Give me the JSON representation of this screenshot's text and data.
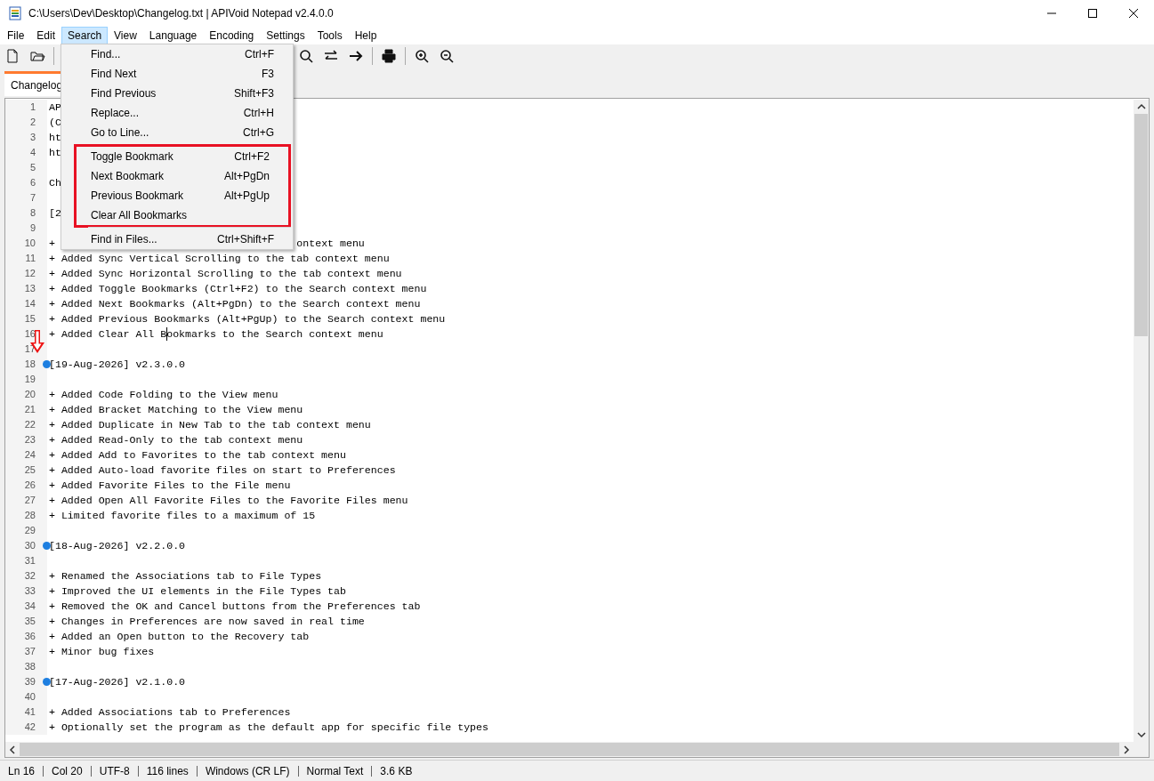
{
  "window": {
    "title": "C:\\Users\\Dev\\Desktop\\Changelog.txt | APIVoid Notepad v2.4.0.0"
  },
  "menu_bar": [
    {
      "label": "File",
      "selected": false
    },
    {
      "label": "Edit",
      "selected": false
    },
    {
      "label": "Search",
      "selected": true
    },
    {
      "label": "View",
      "selected": false
    },
    {
      "label": "Language",
      "selected": false
    },
    {
      "label": "Encoding",
      "selected": false
    },
    {
      "label": "Settings",
      "selected": false
    },
    {
      "label": "Tools",
      "selected": false
    },
    {
      "label": "Help",
      "selected": false
    }
  ],
  "tabs": [
    {
      "label": "Changelog",
      "selected": true
    }
  ],
  "search_menu": {
    "groups": [
      {
        "highlighted": false,
        "items": [
          {
            "label": "Find...",
            "shortcut": "Ctrl+F"
          },
          {
            "label": "Find Next",
            "shortcut": "F3"
          },
          {
            "label": "Find Previous",
            "shortcut": "Shift+F3"
          },
          {
            "label": "Replace...",
            "shortcut": "Ctrl+H"
          },
          {
            "label": "Go to Line...",
            "shortcut": "Ctrl+G"
          }
        ]
      },
      {
        "highlighted": true,
        "items": [
          {
            "label": "Toggle Bookmark",
            "shortcut": "Ctrl+F2"
          },
          {
            "label": "Next Bookmark",
            "shortcut": "Alt+PgDn"
          },
          {
            "label": "Previous Bookmark",
            "shortcut": "Alt+PgUp"
          },
          {
            "label": "Clear All Bookmarks"
          }
        ]
      },
      {
        "highlighted": false,
        "items": [
          {
            "label": "Find in Files...",
            "shortcut": "Ctrl+Shift+F"
          }
        ]
      }
    ]
  },
  "editor": {
    "lines": [
      {
        "number": "1",
        "text": "AP",
        "bookmark": false
      },
      {
        "number": "2",
        "text": "(C",
        "bookmark": false
      },
      {
        "number": "3",
        "text": "ht",
        "bookmark": false
      },
      {
        "number": "4",
        "text": "ht",
        "bookmark": false
      },
      {
        "number": "5",
        "bookmark": false
      },
      {
        "number": "6",
        "text": "Ch",
        "bookmark": false
      },
      {
        "number": "7",
        "bookmark": false
      },
      {
        "number": "8",
        "text": "[2",
        "bookmark": false
      },
      {
        "number": "9",
        "bookmark": false
      },
      {
        "number": "10",
        "text": "+",
        "tail": "ontext menu",
        "bookmark": false
      },
      {
        "number": "11",
        "text": "+ Added Sync Vertical Scrolling to the tab context menu",
        "bookmark": false
      },
      {
        "number": "12",
        "text": "+ Added Sync Horizontal Scrolling to the tab context menu",
        "bookmark": false
      },
      {
        "number": "13",
        "text": "+ Added Toggle Bookmarks (Ctrl+F2) to the Search context menu",
        "bookmark": false
      },
      {
        "number": "14",
        "text": "+ Added Next Bookmarks (Alt+PgDn) to the Search context menu",
        "bookmark": false
      },
      {
        "number": "15",
        "text": "+ Added Previous Bookmarks (Alt+PgUp) to the Search context menu",
        "bookmark": false
      },
      {
        "number": "16",
        "text": "+ Added Clear All Bookmarks to the Search context menu",
        "bookmark": false,
        "caret": true
      },
      {
        "number": "17",
        "bookmark": false
      },
      {
        "number": "18",
        "text": "[19-Aug-2026] v2.3.0.0",
        "bookmark": true
      },
      {
        "number": "19",
        "bookmark": false
      },
      {
        "number": "20",
        "text": "+ Added Code Folding to the View menu",
        "bookmark": false
      },
      {
        "number": "21",
        "text": "+ Added Bracket Matching to the View menu",
        "bookmark": false
      },
      {
        "number": "22",
        "text": "+ Added Duplicate in New Tab to the tab context menu",
        "bookmark": false
      },
      {
        "number": "23",
        "text": "+ Added Read-Only to the tab context menu",
        "bookmark": false
      },
      {
        "number": "24",
        "text": "+ Added Add to Favorites to the tab context menu",
        "bookmark": false
      },
      {
        "number": "25",
        "text": "+ Added Auto-load favorite files on start to Preferences",
        "bookmark": false
      },
      {
        "number": "26",
        "text": "+ Added Favorite Files to the File menu",
        "bookmark": false
      },
      {
        "number": "27",
        "text": "+ Added Open All Favorite Files to the Favorite Files menu",
        "bookmark": false
      },
      {
        "number": "28",
        "text": "+ Limited favorite files to a maximum of 15",
        "bookmark": false
      },
      {
        "number": "29",
        "bookmark": false
      },
      {
        "number": "30",
        "text": "[18-Aug-2026] v2.2.0.0",
        "bookmark": true
      },
      {
        "number": "31",
        "bookmark": false
      },
      {
        "number": "32",
        "text": "+ Renamed the Associations tab to File Types",
        "bookmark": false
      },
      {
        "number": "33",
        "text": "+ Improved the UI elements in the File Types tab",
        "bookmark": false
      },
      {
        "number": "34",
        "text": "+ Removed the OK and Cancel buttons from the Preferences tab",
        "bookmark": false
      },
      {
        "number": "35",
        "text": "+ Changes in Preferences are now saved in real time",
        "bookmark": false
      },
      {
        "number": "36",
        "text": "+ Added an Open button to the Recovery tab",
        "bookmark": false
      },
      {
        "number": "37",
        "text": "+ Minor bug fixes",
        "bookmark": false
      },
      {
        "number": "38",
        "bookmark": false
      },
      {
        "number": "39",
        "text": "[17-Aug-2026] v2.1.0.0",
        "bookmark": true
      },
      {
        "number": "40",
        "bookmark": false
      },
      {
        "number": "41",
        "text": "+ Added Associations tab to Preferences",
        "bookmark": false
      },
      {
        "number": "42",
        "text": "+ Optionally set the program as the default app for specific file types",
        "bookmark": false
      }
    ]
  },
  "status_bar": [
    "Ln 16",
    "Col 20",
    "UTF-8",
    "116 lines",
    "Windows (CR LF)",
    "Normal Text",
    "3.6 KB"
  ]
}
